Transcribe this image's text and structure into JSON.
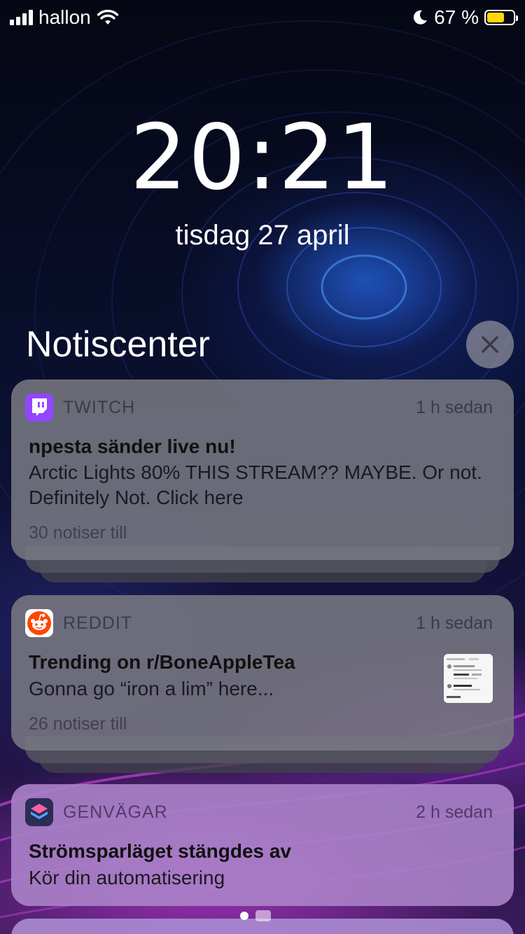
{
  "status": {
    "carrier": "hallon",
    "battery_percent_text": "67 %",
    "battery_level": 0.67,
    "battery_color": "#ffd60a",
    "icons": [
      "signal-bars-icon",
      "wifi-icon",
      "moon-icon",
      "battery-icon"
    ]
  },
  "lock": {
    "time": "20:21",
    "date": "tisdag 27 april"
  },
  "notification_center": {
    "title": "Notiscenter",
    "clear_icon": "close-icon"
  },
  "notifications": [
    {
      "app": "TWITCH",
      "app_icon": "twitch-icon",
      "accent": "#9146ff",
      "time": "1 h sedan",
      "title": "npesta sänder live nu!",
      "body": "Arctic Lights 80% THIS STREAM?? MAYBE. Or not. Definitely Not. Click here",
      "more": "30 notiser till"
    },
    {
      "app": "REDDIT",
      "app_icon": "reddit-icon",
      "accent": "#ff4500",
      "time": "1 h sedan",
      "title": "Trending on r/BoneAppleTea",
      "body": "Gonna go “iron a lim” here...",
      "more": "26 notiser till"
    },
    {
      "app": "GENVÄGAR",
      "app_icon": "shortcuts-icon",
      "accent": "#3b3f9c",
      "time": "2 h sedan",
      "title": "Strömsparläget stängdes av",
      "body": "Kör din automatisering"
    }
  ]
}
